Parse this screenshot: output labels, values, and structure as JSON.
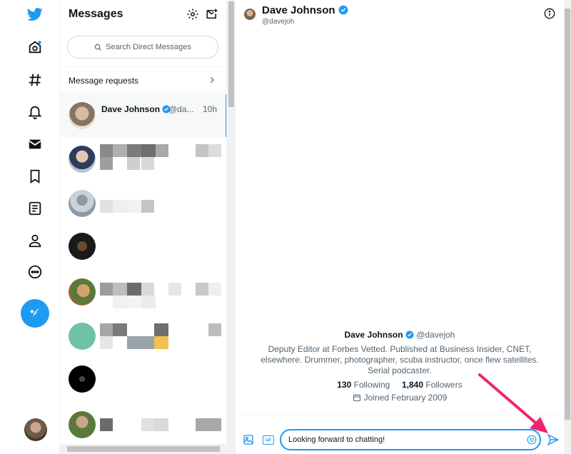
{
  "nav": {
    "items": [
      "twitter-logo",
      "home-icon",
      "explore-icon",
      "notifications-icon",
      "messages-icon",
      "bookmarks-icon",
      "lists-icon",
      "profile-icon",
      "more-icon"
    ],
    "accent": "#1d9bf0"
  },
  "messages": {
    "title": "Messages",
    "search_placeholder": "Search Direct Messages",
    "requests_label": "Message requests",
    "conversations": [
      {
        "name": "Dave Johnson",
        "handle": "@da...",
        "time": "10h",
        "verified": true
      }
    ]
  },
  "conversation": {
    "name": "Dave Johnson",
    "handle": "@davejoh",
    "profile": {
      "name": "Dave Johnson",
      "handle": "@davejoh",
      "bio": "Deputy Editor at Forbes Vetted. Published at Business Insider, CNET, elsewhere. Drummer, photographer, scuba instructor, once flew satellites. Serial podcaster.",
      "following_count": "130",
      "following_label": "Following",
      "followers_count": "1,840",
      "followers_label": "Followers",
      "joined": "Joined February 2009"
    },
    "composer_text": "Looking forward to chatting!"
  },
  "colors": {
    "accent": "#1d9bf0",
    "annotation_arrow": "#f0246d"
  }
}
